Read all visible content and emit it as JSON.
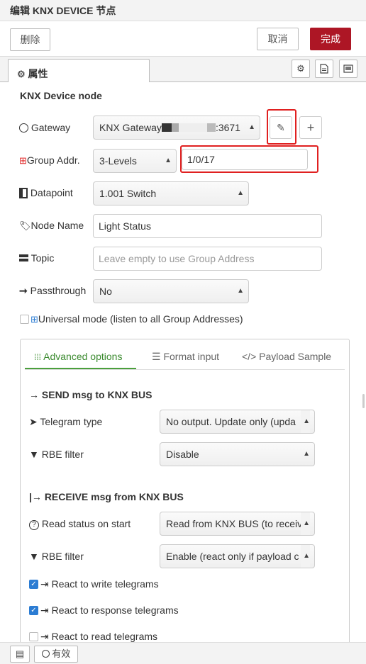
{
  "header": {
    "title": "编辑 KNX DEVICE 节点"
  },
  "toolbar": {
    "delete_label": "删除",
    "cancel_label": "取消",
    "done_label": "完成"
  },
  "tabs": {
    "properties_label": "属性"
  },
  "node": {
    "section_title": "KNX Device node",
    "gateway": {
      "label": "Gateway",
      "prefix": "KNX Gateway",
      "suffix": ":3671"
    },
    "group_addr": {
      "label": "Group Addr.",
      "levels": "3-Levels",
      "value": "1/0/17"
    },
    "datapoint": {
      "label": "Datapoint",
      "value": "1.001 Switch"
    },
    "node_name": {
      "label": "Node Name",
      "value": "Light Status"
    },
    "topic": {
      "label": "Topic",
      "placeholder": "Leave empty to use Group Address"
    },
    "passthrough": {
      "label": "Passthrough",
      "value": "No"
    },
    "universal_mode": {
      "label": "Universal mode (listen to all Group Addresses)",
      "checked": false
    }
  },
  "advanced": {
    "tabs": [
      "Advanced options",
      "Format input",
      "Payload Sample"
    ],
    "send_title": "SEND msg to KNX BUS",
    "telegram_type": {
      "label": "Telegram type",
      "value": "No output. Update only (upda"
    },
    "rbe_send": {
      "label": "RBE filter",
      "value": "Disable"
    },
    "receive_title": "RECEIVE msg from KNX BUS",
    "read_status": {
      "label": "Read status on start",
      "value": "Read from KNX BUS (to receiv"
    },
    "rbe_receive": {
      "label": "RBE filter",
      "value": "Enable (react only if payload c"
    },
    "react_write": {
      "label": "React to write telegrams",
      "checked": true
    },
    "react_response": {
      "label": "React to response telegrams",
      "checked": true
    },
    "react_read": {
      "label": "React to read telegrams",
      "checked": false
    }
  },
  "footer": {
    "enabled_label": "有效"
  },
  "colors": {
    "done_button": "#ad1625",
    "active_tab": "#3a8a2e",
    "highlight": "#e02020",
    "checkbox": "#2b7cd3"
  }
}
